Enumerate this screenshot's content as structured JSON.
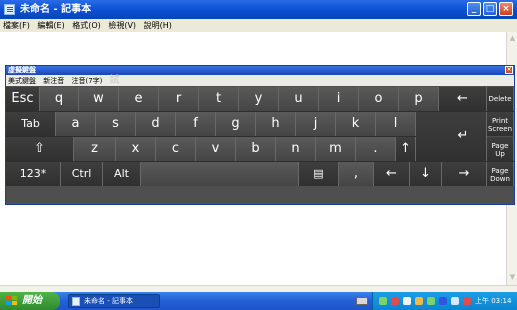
{
  "window": {
    "title": "未命名 - 記事本",
    "menu": [
      "檔案(F)",
      "編輯(E)",
      "格式(O)",
      "檢視(V)",
      "說明(H)"
    ]
  },
  "keyboard": {
    "title": "虛擬鍵盤",
    "tabs": [
      "美式鍵盤",
      "新注音",
      "注音(7字)"
    ],
    "ghost_text": "試",
    "row1": [
      "Esc",
      "q",
      "w",
      "e",
      "r",
      "t",
      "y",
      "u",
      "i",
      "o",
      "p",
      "←",
      "Delete"
    ],
    "row2": [
      "Tab",
      "a",
      "s",
      "d",
      "f",
      "g",
      "h",
      "j",
      "k",
      "l",
      "Print Screen"
    ],
    "row3": [
      "⇧",
      "z",
      "x",
      "c",
      "v",
      "b",
      "n",
      "m",
      ".",
      "↑",
      "↵",
      "Page Up"
    ],
    "row4": [
      "123*",
      "Ctrl",
      "Alt",
      "▤",
      ",",
      "←",
      "↓",
      "→",
      "Page Down"
    ]
  },
  "taskbar": {
    "start_label": "開始",
    "task_label": "未命名 - 記事本",
    "clock": "上午 03:14"
  },
  "colors": {
    "titlebar": "#0a4fd1",
    "keyboard_bg": "#4f4f4f",
    "start_green": "#3a9a37"
  }
}
